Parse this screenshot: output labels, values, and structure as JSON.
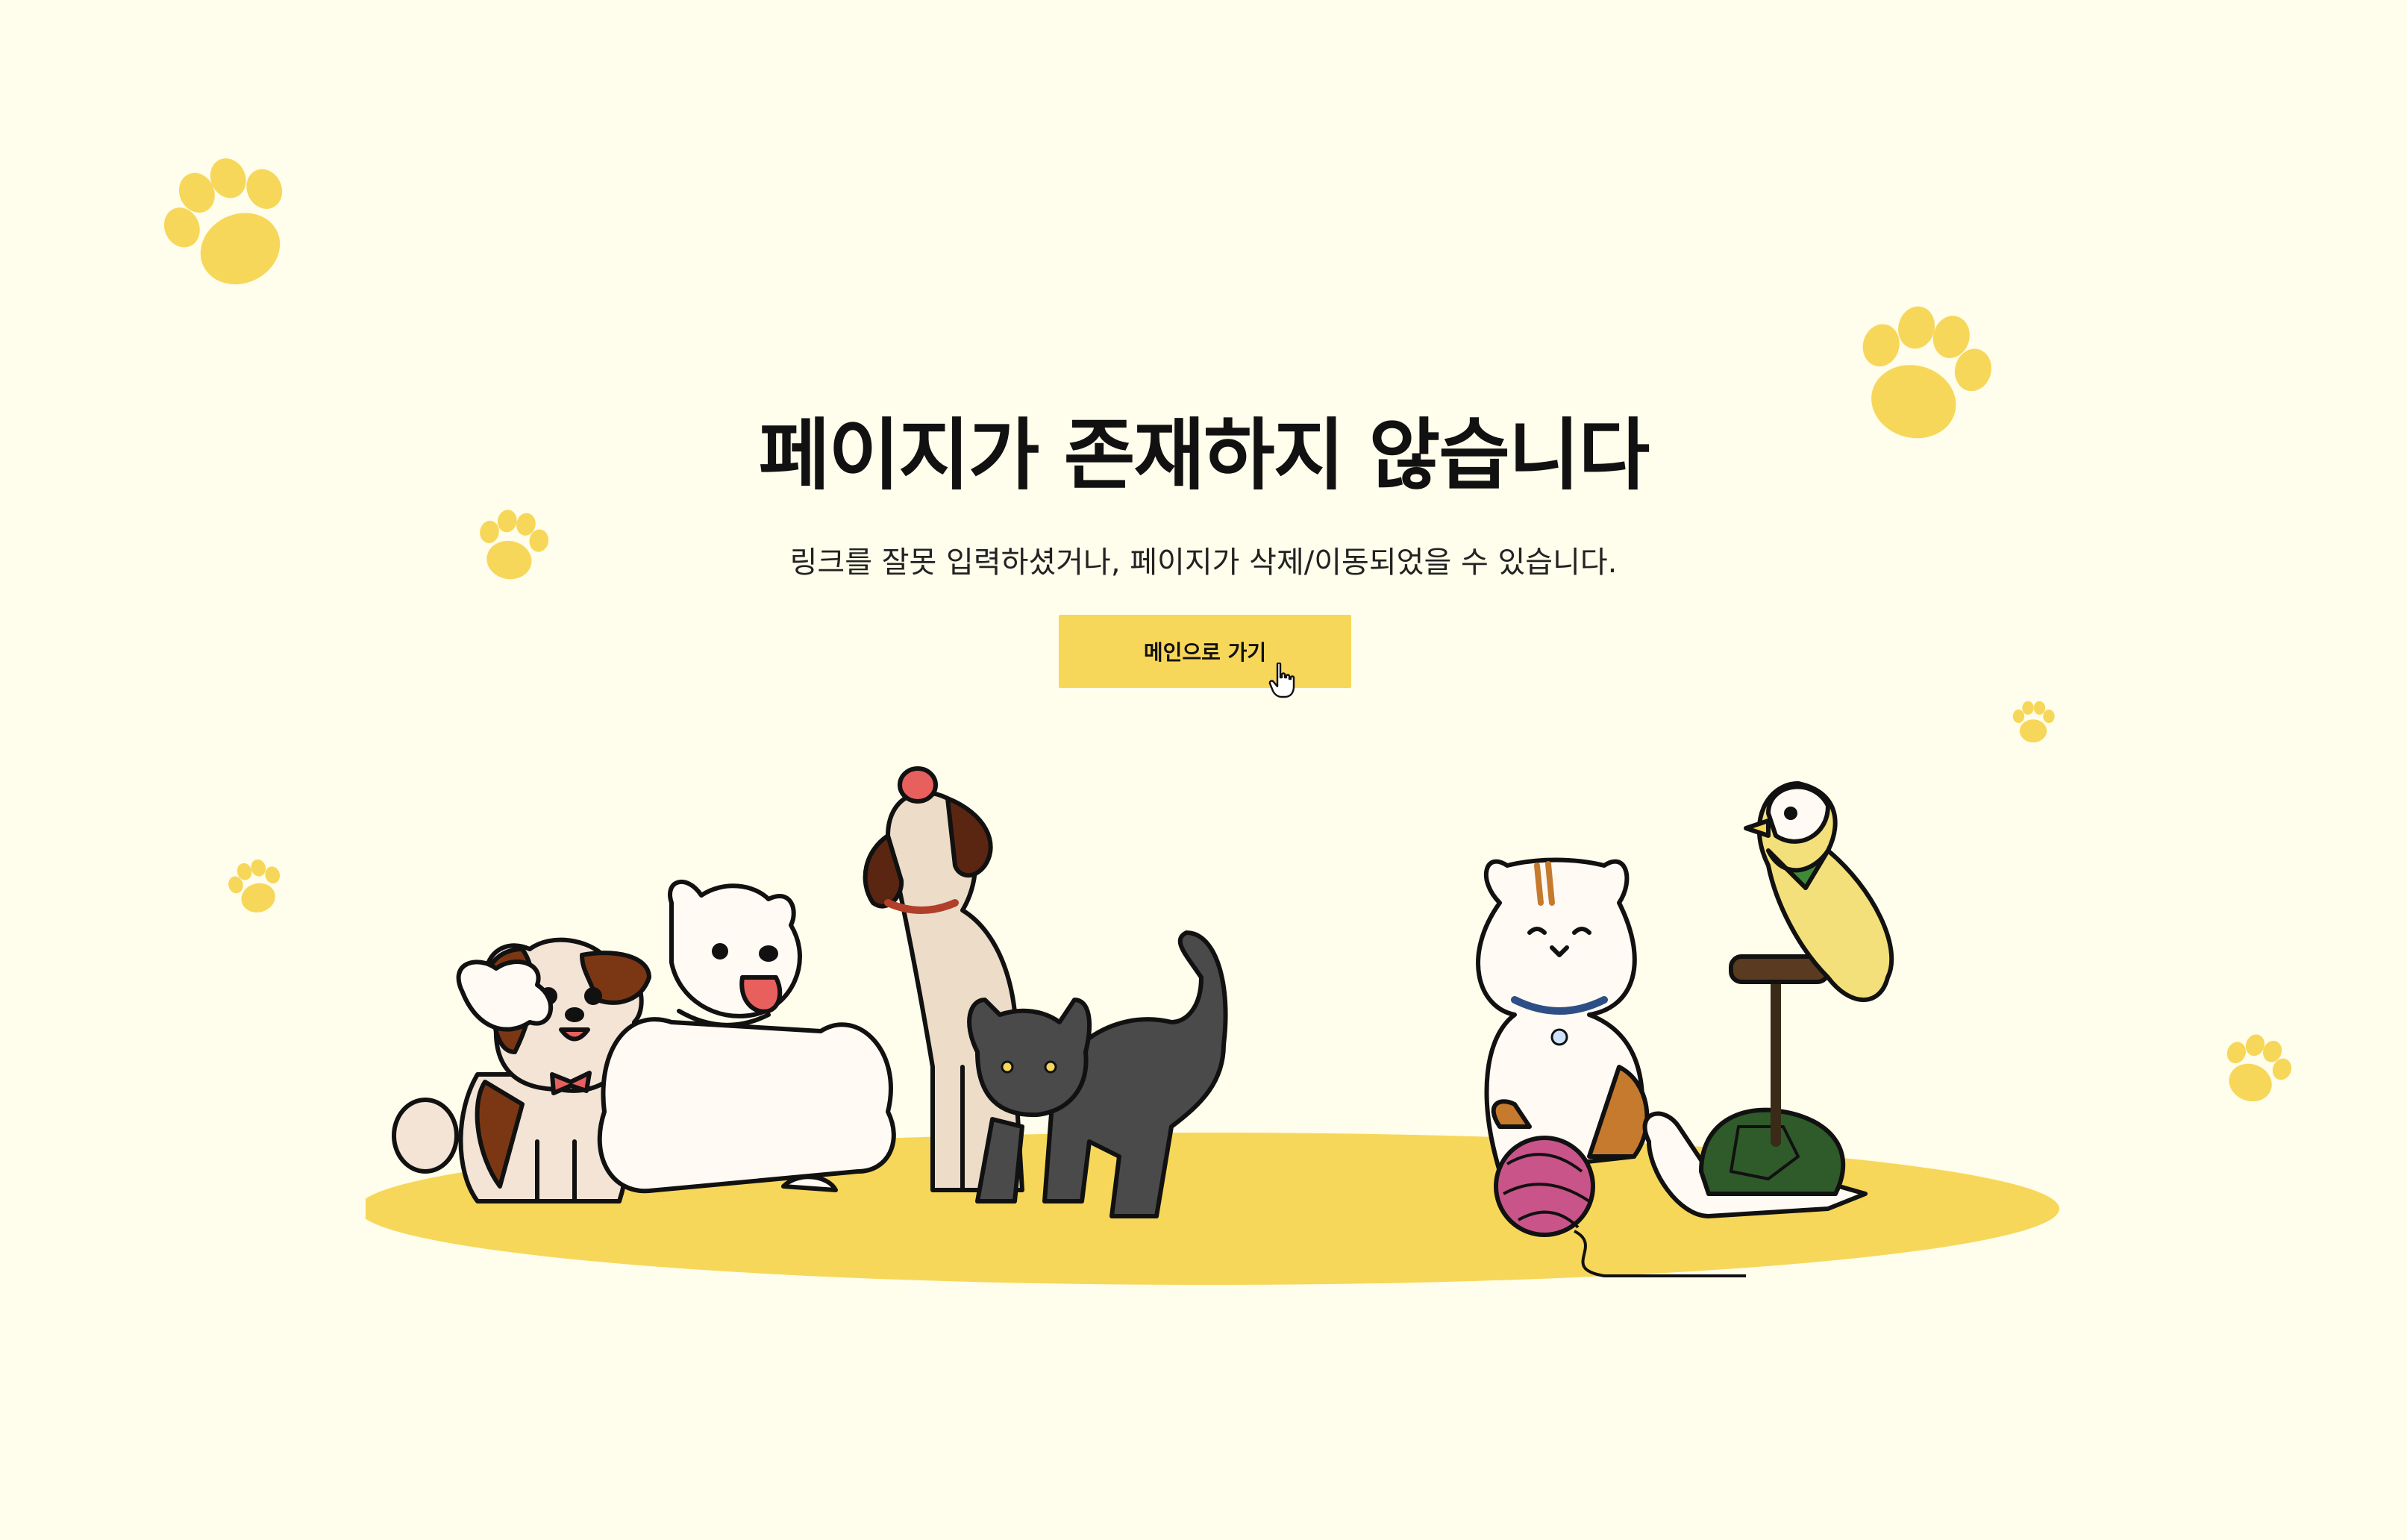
{
  "page": {
    "title": "페이지가 존재하지 않습니다",
    "subtitle": "링크를 잘못 입력하셨거나, 페이지가 삭제/이동되었을 수 있습니다.",
    "main_button_label": "메인으로 가기"
  },
  "colors": {
    "background": "#fffdeb",
    "accent_yellow": "#f7d75a",
    "text_dark": "#111111"
  },
  "icons": {
    "decorative": "paw-print-icon",
    "cursor": "hand-pointer-cursor-icon"
  }
}
